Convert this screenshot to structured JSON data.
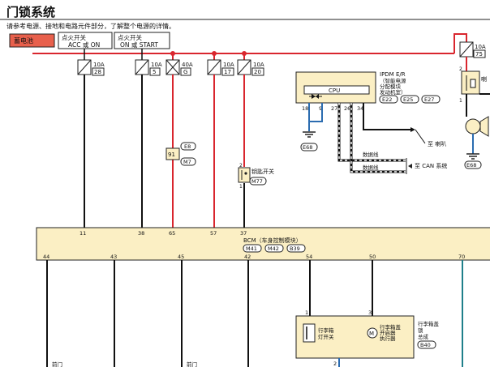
{
  "title": "门锁系统",
  "subtitle": "请参考电源、接地和电路元件部分，了解整个电源的详情。",
  "battery": "蓄电池",
  "supply": {
    "acc": [
      "点火开关",
      "ACC 或 ON"
    ],
    "start": [
      "点火开关",
      "ON 或 START"
    ]
  },
  "fuses": [
    {
      "amp": "10A",
      "num": "28"
    },
    {
      "amp": "10A",
      "num": "5"
    },
    {
      "amp": "40A",
      "num": "G"
    },
    {
      "amp": "10A",
      "num": "17"
    },
    {
      "amp": "10A",
      "num": "20"
    },
    {
      "amp": "10A",
      "num": "75"
    }
  ],
  "connectors": {
    "e8": "E8",
    "m7": "M7",
    "j91": "91",
    "m77": "M77",
    "e68": "E68",
    "e68b": "E68",
    "e22": "E22",
    "e25": "E25",
    "e27": "E27",
    "m41": "M41",
    "m42": "M42",
    "b39": "B39",
    "b40": "B40"
  },
  "key_switch": "钥匙开关",
  "ipdm": {
    "title": "IPDM E/R",
    "lines": [
      "（智能电源",
      "分配模块",
      "发动机室）"
    ],
    "cpu": "CPU"
  },
  "ipdm_pins": [
    "18",
    "9",
    "27",
    "26",
    "34"
  ],
  "horn_label": "至 喇叭",
  "data_line": "数据线",
  "can_label": "至 CAN 系统",
  "relay": {
    "pin_top": "2",
    "pin_bottom": "1",
    "label": "喇"
  },
  "bcm": {
    "title": "BCM（车身控制模块）"
  },
  "bcm_top_pins": [
    "11",
    "38",
    "65",
    "57",
    "37"
  ],
  "bcm_bottom_pins": [
    "44",
    "43",
    "45",
    "42",
    "54",
    "50",
    "70"
  ],
  "fuse_pin_top": "2",
  "fuse_pin_bottom": "1",
  "trunk": {
    "pin1": "1",
    "pin3": "3",
    "pin2": "2",
    "switch_label": [
      "行李箱",
      "灯开关"
    ],
    "motor_label": [
      "行李箱盖",
      "开启器",
      "执行器"
    ],
    "assembly": [
      "行李箱盖",
      "锁",
      "总成"
    ]
  },
  "bottom_labels": [
    "前门",
    "前门"
  ],
  "colors": {
    "battery_fill": "#e8604c",
    "power": "#d9262e",
    "signal": "#111111",
    "ground": "#2b6cb0",
    "teal": "#1f7f8a",
    "bcm_fill": "#fbefc4",
    "ipdm_fill": "#fbefc4"
  }
}
